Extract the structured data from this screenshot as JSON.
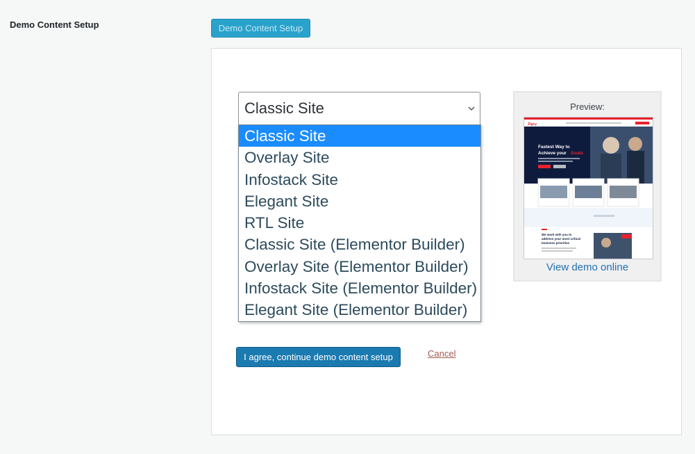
{
  "setting": {
    "label": "Demo Content Setup",
    "button_label": "Demo Content Setup"
  },
  "select": {
    "current": "Classic Site",
    "options": [
      "Classic Site",
      "Overlay Site",
      "Infostack Site",
      "Elegant Site",
      "RTL Site",
      "Classic Site (Elementor Builder)",
      "Overlay Site (Elementor Builder)",
      "Infostack Site (Elementor Builder)",
      "Elegant Site (Elementor Builder)"
    ],
    "highlighted_index": 0
  },
  "preview": {
    "label": "Preview:",
    "link": "View demo online",
    "thumb": {
      "logo": "Zigcy",
      "headline_1": "Fastest Way to",
      "headline_2": "Achieve your",
      "headline_accent": "Goals",
      "section_1": "We work with you to",
      "section_2": "address your most critical",
      "section_3": "business priorities"
    }
  },
  "actions": {
    "agree_label": "I agree, continue demo content setup",
    "cancel_label": "Cancel"
  },
  "colors": {
    "accent_blue": "#1a8cff",
    "button_blue": "#1b7ab0",
    "thumb_red": "#e8212d",
    "thumb_navy": "#0f1b3d"
  }
}
